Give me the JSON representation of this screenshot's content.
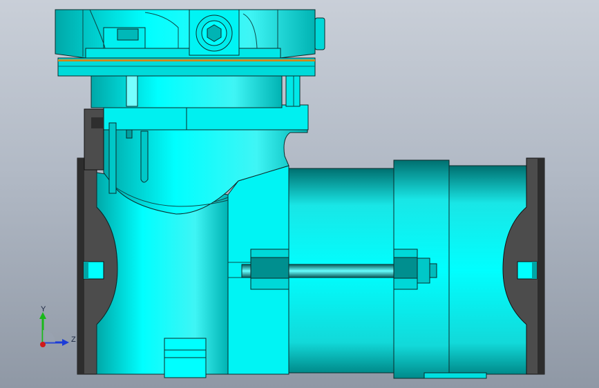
{
  "triad": {
    "y_label": "Y",
    "z_label": "Z"
  },
  "colors": {
    "body": "#00ffff",
    "body_shade": "#00c2c2",
    "body_dark": "#007f7f",
    "flange": "#4b4b4b",
    "flange_dark": "#2e2e2e",
    "gasket": "#d08a1a",
    "outline": "#0c2a2a",
    "axis_y": "#19b919",
    "axis_z": "#1c3cd8",
    "axis_x": "#d01a1a"
  }
}
